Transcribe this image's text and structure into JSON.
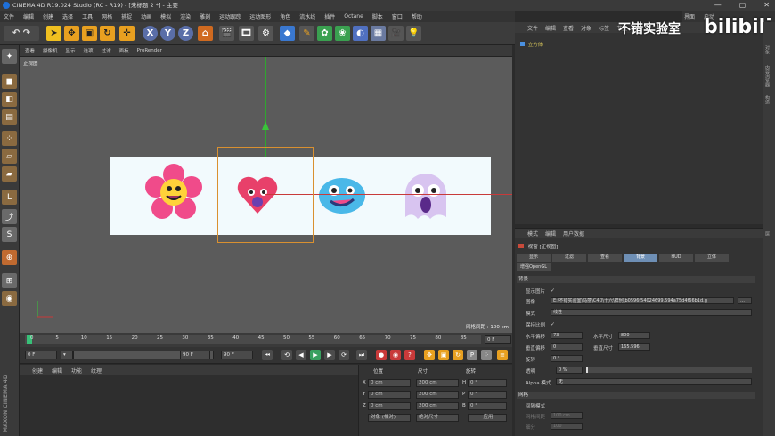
{
  "window": {
    "title": "CINEMA 4D R19.024 Studio (RC - R19) - [未标题 2 *] - 主要",
    "controls": [
      "—",
      "▢",
      "✕"
    ]
  },
  "menu": [
    "文件",
    "编辑",
    "创建",
    "选择",
    "工具",
    "网格",
    "捕捉",
    "动画",
    "模拟",
    "渲染",
    "雕刻",
    "运动跟踪",
    "运动图形",
    "角色",
    "流水线",
    "插件",
    "Octane",
    "脚本",
    "窗口",
    "帮助"
  ],
  "menu_right": [
    "界面",
    "启动"
  ],
  "watermark": {
    "text": "不错实验室",
    "brand": "bilibili"
  },
  "viewport": {
    "menu": [
      "查看",
      "摄像机",
      "显示",
      "选项",
      "过滤",
      "面板",
      "ProRender"
    ],
    "label": "正视图",
    "grid_label": "网格间距 : 100 cm"
  },
  "timeline": {
    "ticks": [
      "0",
      "5",
      "10",
      "15",
      "20",
      "25",
      "30",
      "35",
      "40",
      "45",
      "50",
      "55",
      "60",
      "65",
      "70",
      "75",
      "80",
      "85",
      "90"
    ],
    "frame_right": "0 F",
    "start": "0 F",
    "current": "0 F",
    "end_a": "90 F",
    "end_b": "90 F"
  },
  "materials": {
    "menu": [
      "创建",
      "编辑",
      "功能",
      "纹理"
    ]
  },
  "coords": {
    "headers": [
      "位置",
      "尺寸",
      "旋转"
    ],
    "rows": [
      {
        "axis": "X",
        "pos": "0 cm",
        "size": "200 cm",
        "rot_label": "H",
        "rot": "0 °"
      },
      {
        "axis": "Y",
        "pos": "0 cm",
        "size": "200 cm",
        "rot_label": "P",
        "rot": "0 °"
      },
      {
        "axis": "Z",
        "pos": "0 cm",
        "size": "200 cm",
        "rot_label": "B",
        "rot": "0 °"
      }
    ],
    "mode1": "对象 (相对)",
    "mode2": "绝对尺寸",
    "apply": "应用"
  },
  "objects": {
    "menu": [
      "文件",
      "编辑",
      "查看",
      "对象",
      "标签",
      "书签"
    ],
    "items": [
      "立方体"
    ]
  },
  "attributes": {
    "menu": [
      "模式",
      "编辑",
      "用户数据"
    ],
    "title": "视窗 [正视图]",
    "tabs": [
      "显示",
      "过滤",
      "查看",
      "背景",
      "HUD",
      "立体"
    ],
    "active_tab": "背景",
    "extra_tab": "增强OpenGL",
    "section": "背景",
    "rows": {
      "show_image": "显示图片",
      "image_label": "图像",
      "image_path": "E:\\不错实验室\\马丽\\C4D\\十六\\样例\\b0596f54024699.594a75d4f66b1d.g",
      "mode_label": "模式",
      "mode_value": "线性",
      "keep_ratio": "保持比例",
      "h_offset_label": "水平偏移",
      "h_offset": "73",
      "h_size_label": "水平尺寸",
      "h_size": "800",
      "v_offset_label": "垂直偏移",
      "v_offset": "0",
      "v_size_label": "垂直尺寸",
      "v_size": "165.596",
      "rotate_label": "旋转",
      "rotate": "0 °",
      "transparency_label": "透明",
      "transparency": "0 %",
      "alpha_label": "Alpha 模式",
      "alpha_value": "无"
    },
    "section2": "网格",
    "rows2": {
      "spacing_mode": "间隔模式",
      "grid_spacing": "网格间距",
      "grid_spacing_val": "100 cm",
      "subdivide": "细分",
      "subdivide_val": "100"
    }
  },
  "side_tabs": [
    "对象",
    "内容浏览器",
    "构造",
    "层"
  ],
  "maxon": "MAXON CINEMA 4D"
}
